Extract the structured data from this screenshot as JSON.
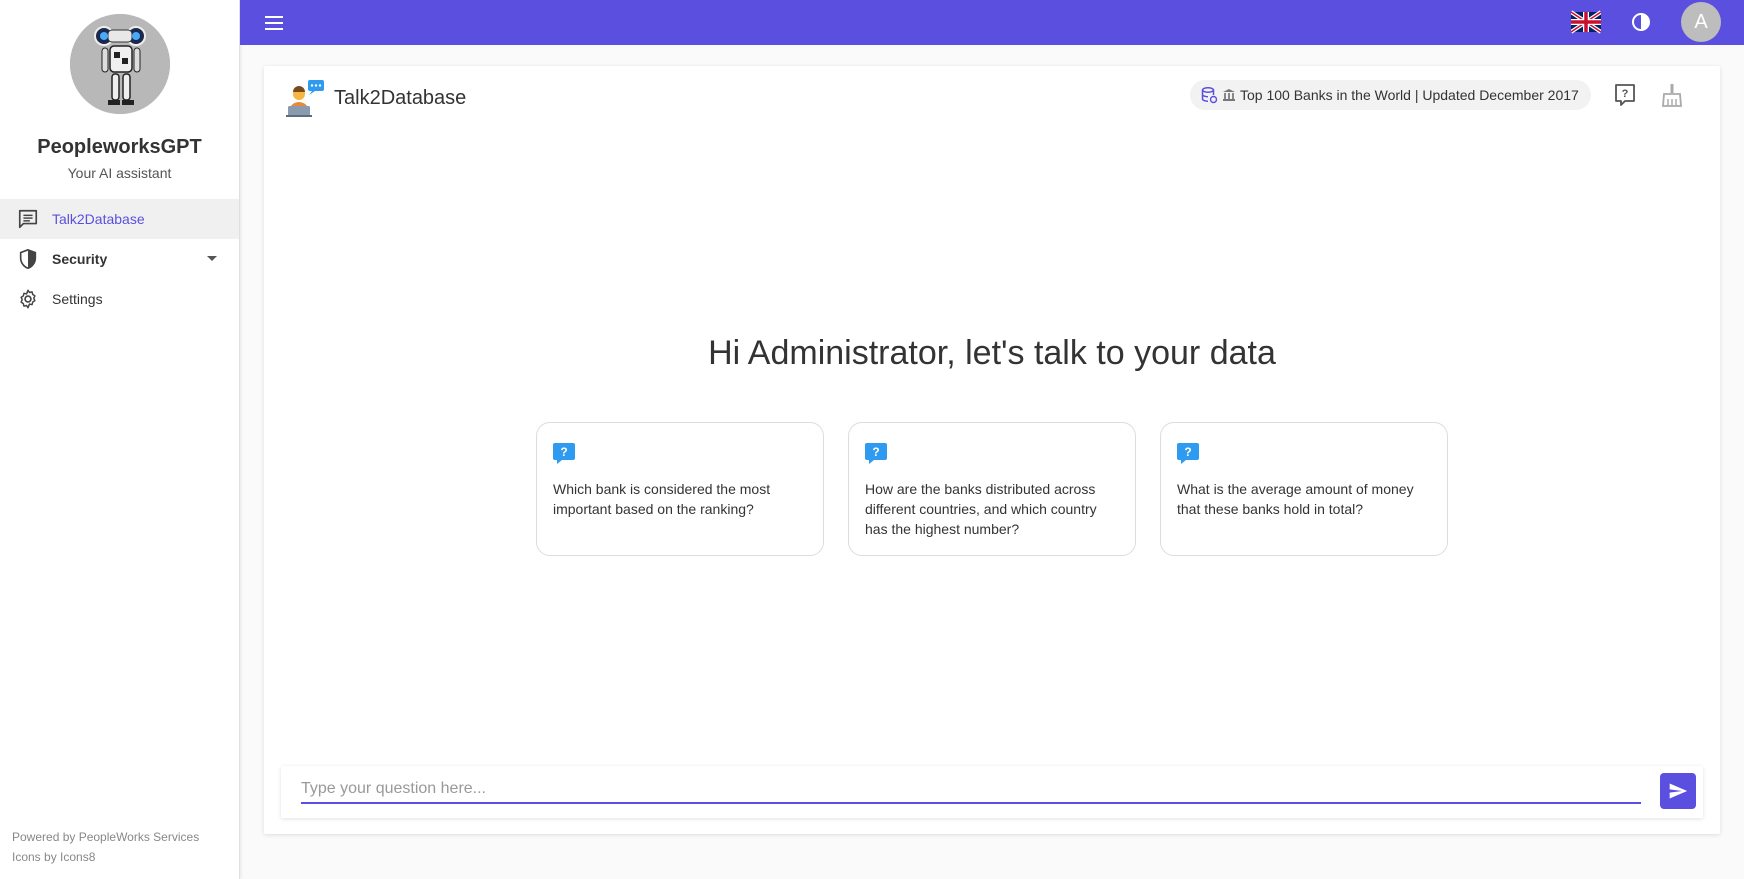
{
  "sidebar": {
    "app_name": "PeopleworksGPT",
    "app_subtitle": "Your AI assistant",
    "items": [
      {
        "label": "Talk2Database",
        "icon": "chat-icon",
        "active": true
      },
      {
        "label": "Security",
        "icon": "shield-icon",
        "expandable": true
      },
      {
        "label": "Settings",
        "icon": "gear-icon"
      }
    ],
    "footer": {
      "powered_by": "Powered by PeopleWorks Services",
      "icons_by": "Icons by Icons8"
    }
  },
  "topbar": {
    "menu_icon": "hamburger-icon",
    "language_icon": "uk-flag-icon",
    "theme_icon": "contrast-icon",
    "user_initial": "A"
  },
  "main": {
    "title": "Talk2Database",
    "database_chip": "Top 100 Banks in the World | Updated December 2017",
    "greeting": "Hi Administrator, let's talk to your data",
    "suggestions": [
      {
        "text": "Which bank is considered the most important based on the ranking?"
      },
      {
        "text": "How are the banks distributed across different countries, and which country has the highest number?"
      },
      {
        "text": "What is the average amount of money that these banks hold in total?"
      }
    ],
    "input": {
      "placeholder": "Type your question here...",
      "value": ""
    }
  },
  "colors": {
    "accent": "#5b4fe0",
    "question_icon": "#2f9bf0"
  }
}
